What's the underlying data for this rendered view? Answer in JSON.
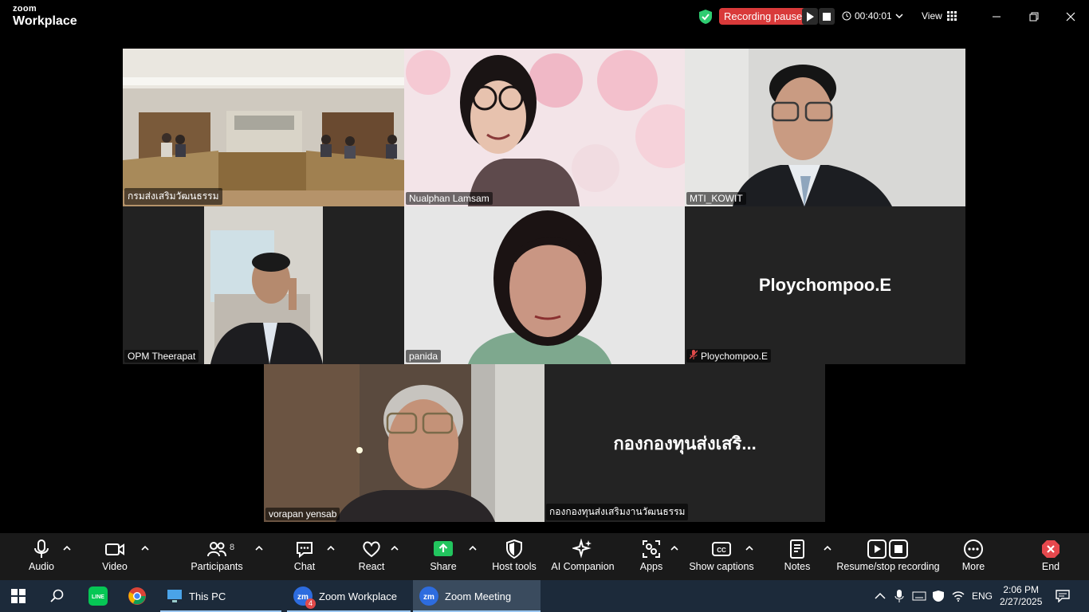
{
  "app": {
    "brand_top": "zoom",
    "brand_main": "Workplace"
  },
  "topbar": {
    "recording_status": "Recording paused",
    "timer": "00:40:01",
    "view_label": "View"
  },
  "tiles": [
    {
      "name": "กรมส่งเสริมวัฒนธรรม",
      "active": true
    },
    {
      "name": "Nualphan Lamsam"
    },
    {
      "name": "MTI_KOWIT"
    },
    {
      "name": "OPM Theerapat"
    },
    {
      "name": "panida"
    },
    {
      "name": "Ploychompoo.E",
      "big_name": "Ploychompoo.E",
      "muted": true
    },
    {
      "name": "vorapan yensab"
    },
    {
      "name": "กองกองทุนส่งเสริมงานวัฒนธรรม",
      "big_name": "กองกองทุนส่งเสริ..."
    }
  ],
  "toolbar": {
    "audio": "Audio",
    "video": "Video",
    "participants": "Participants",
    "participants_count": "8",
    "chat": "Chat",
    "react": "React",
    "share": "Share",
    "host_tools": "Host tools",
    "ai_companion": "AI Companion",
    "apps": "Apps",
    "captions": "Show captions",
    "notes": "Notes",
    "recording": "Resume/stop recording",
    "more": "More",
    "end": "End"
  },
  "taskbar": {
    "apps": [
      {
        "label": "This PC"
      },
      {
        "label": "Zoom Workplace",
        "badge": "4"
      },
      {
        "label": "Zoom Meeting",
        "active": true
      }
    ],
    "language": "ENG",
    "time": "2:06 PM",
    "date": "2/27/2025"
  },
  "colors": {
    "accent_green": "#2ecc71",
    "record_red": "#d93a3a",
    "share_green": "#22c55e",
    "end_red": "#e5484d"
  }
}
